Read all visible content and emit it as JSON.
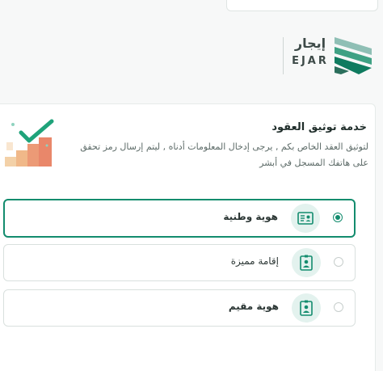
{
  "header": {
    "top_bar_text": "",
    "logo_arabic": "إيجار",
    "logo_english": "EJAR"
  },
  "service": {
    "title": "خدمة توثيق العقود",
    "description": "لتوثيق العقد الخاص بكم , يرجى إدخال المعلومات أدناه , ليتم إرسال رمز تحقق على هاتفك المسجل في أبشر"
  },
  "options": [
    {
      "label": "هوية وطنية",
      "selected": true,
      "icon": "id-card-icon"
    },
    {
      "label": "إقامة مميزة",
      "selected": false,
      "icon": "id-badge-icon"
    },
    {
      "label": "هوية مقيم",
      "selected": false,
      "icon": "id-badge-icon"
    }
  ],
  "colors": {
    "accent": "#138c6e",
    "icon_bg": "#e3f2ee",
    "illustration_orange": "#f0a37e",
    "illustration_check": "#1fa37a"
  }
}
